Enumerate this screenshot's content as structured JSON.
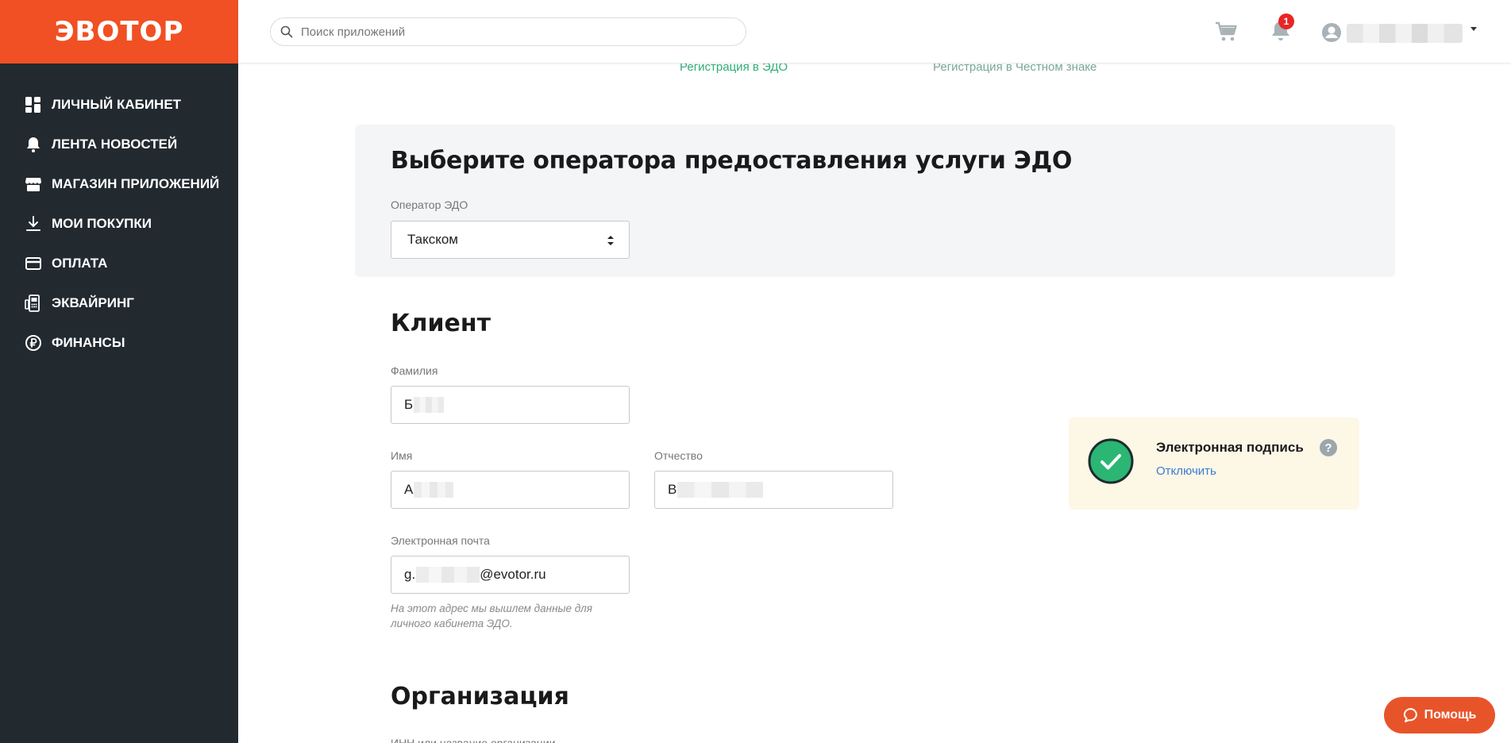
{
  "brand": {
    "logo": "ЭВОТОР",
    "color": "#f05023"
  },
  "sidebar": {
    "items": [
      {
        "label": "ЛИЧНЫЙ КАБИНЕТ",
        "icon": "dashboard-icon"
      },
      {
        "label": "ЛЕНТА НОВОСТЕЙ",
        "icon": "bell-icon"
      },
      {
        "label": "МАГАЗИН ПРИЛОЖЕНИЙ",
        "icon": "store-icon"
      },
      {
        "label": "МОИ ПОКУПКИ",
        "icon": "download-icon"
      },
      {
        "label": "ОПЛАТА",
        "icon": "card-icon"
      },
      {
        "label": "ЭКВАЙРИНГ",
        "icon": "pos-terminal-icon"
      },
      {
        "label": "ФИНАНСЫ",
        "icon": "ruble-icon"
      }
    ]
  },
  "header": {
    "search_placeholder": "Поиск приложений",
    "notifications_count": "1"
  },
  "steps": [
    "Регистрация в ЭДО",
    "Регистрация в Честном знаке"
  ],
  "operator": {
    "title": "Выберите оператора предоставления услуги ЭДО",
    "label": "Оператор ЭДО",
    "selected": "Такском"
  },
  "client": {
    "title": "Клиент",
    "surname_label": "Фамилия",
    "surname_value": "Б",
    "name_label": "Имя",
    "name_value": "А",
    "patronymic_label": "Отчество",
    "patronymic_value": "В",
    "email_label": "Электронная почта",
    "email_prefix": "g.",
    "email_suffix": "@evotor.ru",
    "email_hint": "На этот адрес мы вышлем данные для личного кабинета ЭДО."
  },
  "signature": {
    "title": "Электронная подпись",
    "help": "?",
    "link": "Отключить"
  },
  "organization": {
    "title": "Организация",
    "label": "ИНН или название организации"
  },
  "help_button": "Помощь"
}
